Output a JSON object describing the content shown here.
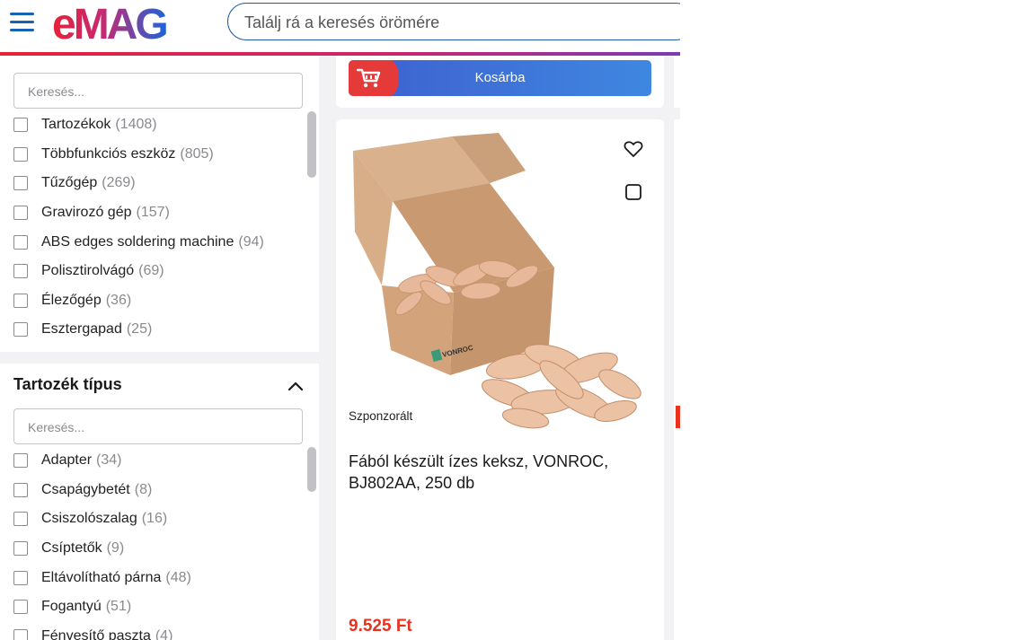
{
  "header": {
    "logo_text": "eMAG",
    "search_placeholder": "Találj rá a keresés örömére",
    "brand_colors": {
      "red": "#e5233a",
      "blue": "#1662b3",
      "purple": "#7b3bb5"
    }
  },
  "filter_type": {
    "title": "",
    "search_placeholder": "Keresés...",
    "items": [
      {
        "label": "Tartozékok",
        "count": "(1408)"
      },
      {
        "label": "Többfunkciós eszköz",
        "count": "(805)"
      },
      {
        "label": "Tűzőgép",
        "count": "(269)"
      },
      {
        "label": "Gravirozó gép",
        "count": "(157)"
      },
      {
        "label": "ABS edges soldering machine",
        "count": "(94)"
      },
      {
        "label": "Polisztirolvágó",
        "count": "(69)"
      },
      {
        "label": "Élezőgép",
        "count": "(36)"
      },
      {
        "label": "Esztergapad",
        "count": "(25)"
      }
    ]
  },
  "filter_accessory": {
    "title": "Tartozék típus",
    "search_placeholder": "Keresés...",
    "items": [
      {
        "label": "Adapter",
        "count": "(34)"
      },
      {
        "label": "Csapágybetét",
        "count": "(8)"
      },
      {
        "label": "Csiszolószalag",
        "count": "(16)"
      },
      {
        "label": "Csíptetők",
        "count": "(9)"
      },
      {
        "label": "Eltávolítható párna",
        "count": "(48)"
      },
      {
        "label": "Fogantyú",
        "count": "(51)"
      },
      {
        "label": "Fényesítő paszta",
        "count": "(4)"
      }
    ]
  },
  "cart_button": {
    "label": "Kosárba"
  },
  "product": {
    "sponsored": "Szponzorált",
    "title": "Fából készült ízes keksz, VONROC, BJ802AA, 250 db",
    "price": "9.525 Ft",
    "price_color": "#e8321e",
    "box_brand": "VONROC"
  }
}
